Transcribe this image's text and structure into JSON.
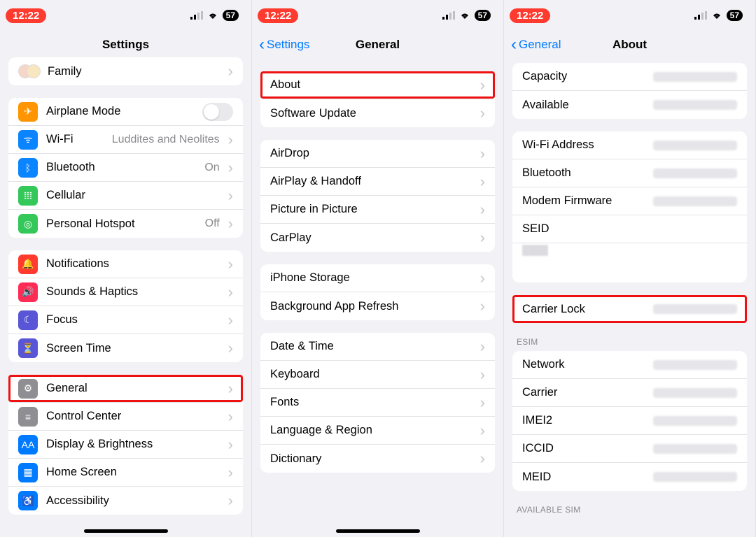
{
  "status": {
    "time": "12:22",
    "battery": "57"
  },
  "p1": {
    "title": "Settings",
    "family": "Family",
    "items1": [
      {
        "label": "Airplane Mode",
        "detail": "",
        "toggle": true,
        "color": "ic-orange",
        "icon": "airplane"
      },
      {
        "label": "Wi-Fi",
        "detail": "Luddites and Neolites",
        "color": "ic-blue",
        "icon": "wifi"
      },
      {
        "label": "Bluetooth",
        "detail": "On",
        "color": "ic-blue",
        "icon": "bluetooth"
      },
      {
        "label": "Cellular",
        "detail": "",
        "color": "ic-green",
        "icon": "antenna"
      },
      {
        "label": "Personal Hotspot",
        "detail": "Off",
        "color": "ic-green",
        "icon": "hotspot"
      }
    ],
    "items2": [
      {
        "label": "Notifications",
        "color": "ic-red",
        "icon": "bell"
      },
      {
        "label": "Sounds & Haptics",
        "color": "ic-pink",
        "icon": "speaker"
      },
      {
        "label": "Focus",
        "color": "ic-purple",
        "icon": "moon"
      },
      {
        "label": "Screen Time",
        "color": "ic-purple",
        "icon": "hourglass"
      }
    ],
    "items3": [
      {
        "label": "General",
        "color": "ic-gray",
        "icon": "gear",
        "hl": true
      },
      {
        "label": "Control Center",
        "color": "ic-gray",
        "icon": "switches"
      },
      {
        "label": "Display & Brightness",
        "color": "ic-darkblue",
        "icon": "Aa"
      },
      {
        "label": "Home Screen",
        "color": "ic-darkblue",
        "icon": "grid"
      },
      {
        "label": "Accessibility",
        "color": "ic-darkblue",
        "icon": "person"
      }
    ]
  },
  "p2": {
    "back": "Settings",
    "title": "General",
    "g1": [
      {
        "label": "About",
        "hl": true
      },
      {
        "label": "Software Update"
      }
    ],
    "g2": [
      {
        "label": "AirDrop"
      },
      {
        "label": "AirPlay & Handoff"
      },
      {
        "label": "Picture in Picture"
      },
      {
        "label": "CarPlay"
      }
    ],
    "g3": [
      {
        "label": "iPhone Storage"
      },
      {
        "label": "Background App Refresh"
      }
    ],
    "g4": [
      {
        "label": "Date & Time"
      },
      {
        "label": "Keyboard"
      },
      {
        "label": "Fonts"
      },
      {
        "label": "Language & Region"
      },
      {
        "label": "Dictionary"
      }
    ]
  },
  "p3": {
    "back": "General",
    "title": "About",
    "g1": [
      {
        "label": "Capacity",
        "blur": true
      },
      {
        "label": "Available",
        "blur": true
      }
    ],
    "g2": [
      {
        "label": "Wi-Fi Address",
        "blur": true
      },
      {
        "label": "Bluetooth",
        "blur": true
      },
      {
        "label": "Modem Firmware",
        "blur": true
      },
      {
        "label": "SEID"
      },
      {
        "label": "",
        "sub": true
      }
    ],
    "g3": [
      {
        "label": "Carrier Lock",
        "blur": true,
        "hl": true
      }
    ],
    "sec1": "ESIM",
    "g4": [
      {
        "label": "Network",
        "blur": true
      },
      {
        "label": "Carrier",
        "blur": true
      },
      {
        "label": "IMEI2",
        "blur": true
      },
      {
        "label": "ICCID",
        "blur": true
      },
      {
        "label": "MEID",
        "blur": true
      }
    ],
    "sec2": "AVAILABLE SIM"
  }
}
